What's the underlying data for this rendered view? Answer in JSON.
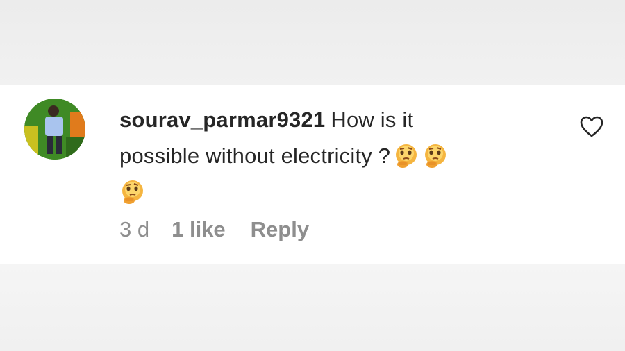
{
  "comment": {
    "username": "sourav_parmar9321",
    "text_line1": "How is it",
    "text_line2": "possible without electricity ?",
    "emoji_icon": "thinking-face-emoji",
    "age": "3 d",
    "likes": "1 like",
    "reply_label": "Reply"
  },
  "colors": {
    "text": "#262626",
    "secondary_text": "#8e8e8e",
    "card_background": "#ffffff",
    "page_background": "#efefef"
  }
}
